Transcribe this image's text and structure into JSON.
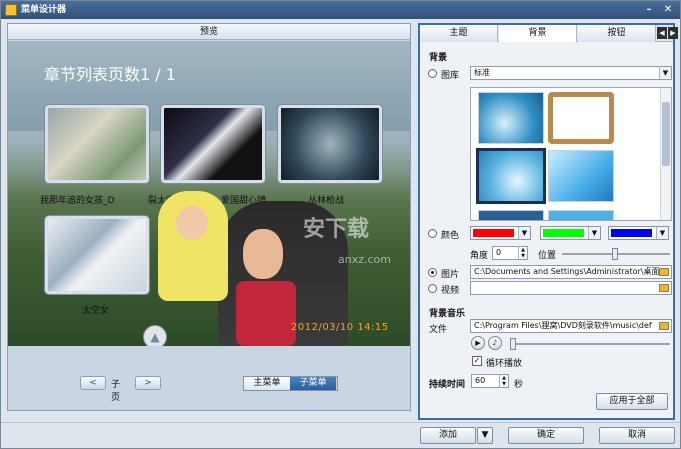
{
  "window": {
    "title": "菜单设计器"
  },
  "preview": {
    "header": "预览",
    "page_title": "章节列表页数1 / 1",
    "chapter_captions": [
      "我那年追的女孩_D",
      "裂太空仙女",
      "爱国甜心镜",
      "丛林枪战",
      "太空女"
    ],
    "date_stamp": "2012/03/10 14:15",
    "watermark": "安下载",
    "watermark_sub": "anxz.com",
    "pager_label": "子页",
    "pager_prev": "<",
    "pager_next": ">",
    "menu_tabs": [
      "主菜单",
      "子菜单"
    ]
  },
  "tabs": [
    "主题",
    "背景",
    "按钮"
  ],
  "background": {
    "section_title": "背景",
    "gallery_label": "图库",
    "gallery_value": "标准",
    "color_label": "颜色",
    "colors": [
      "#ff0000",
      "#00ff00",
      "#0000ff"
    ],
    "angle_label": "角度",
    "angle_value": "0",
    "position_label": "位置",
    "image_label": "图片",
    "image_path": "C:\\Documents and Settings\\Administrator\\桌面",
    "video_label": "视频",
    "video_path": ""
  },
  "music": {
    "section_title": "背景音乐",
    "file_label": "文件",
    "file_path": "C:\\Program Files\\狸窝\\DVD刻录软件\\music\\def",
    "loop_label": "循环播放",
    "loop_checked": true
  },
  "duration": {
    "label": "持续时间",
    "value": "60",
    "unit": "秒"
  },
  "apply_all": "应用于全部",
  "footer": {
    "add": "添加",
    "ok": "确定",
    "cancel": "取消"
  }
}
